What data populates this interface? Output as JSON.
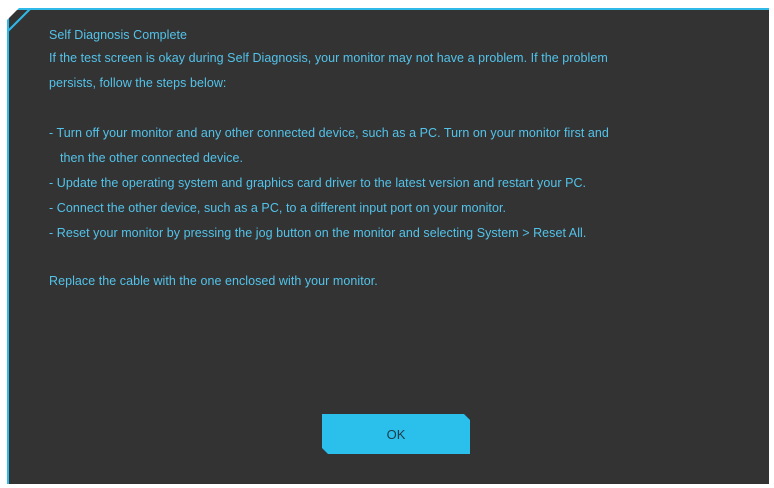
{
  "dialog": {
    "title": "Self Diagnosis Complete",
    "intro_line1": "If the test screen is okay during Self Diagnosis, your monitor may not have a problem. If the problem",
    "intro_line2": "persists, follow the steps below:",
    "steps": [
      {
        "line1": "- Turn off your monitor and any other connected device, such as a PC. Turn on your monitor first and",
        "line2": "then the other connected device."
      },
      {
        "line1": "- Update the operating system and graphics card driver to the latest version and restart your PC."
      },
      {
        "line1": "- Connect the other device, such as a PC, to a different input port on your monitor."
      },
      {
        "line1": "- Reset your monitor by pressing the jog button on the monitor and selecting System > Reset All."
      }
    ],
    "cable_note": "Replace the cable with the one enclosed with your monitor.",
    "ok_label": "OK"
  },
  "colors": {
    "background": "#333333",
    "text": "#53c3ea",
    "accent": "#2bbfec",
    "button_text": "#1b3c4a"
  }
}
